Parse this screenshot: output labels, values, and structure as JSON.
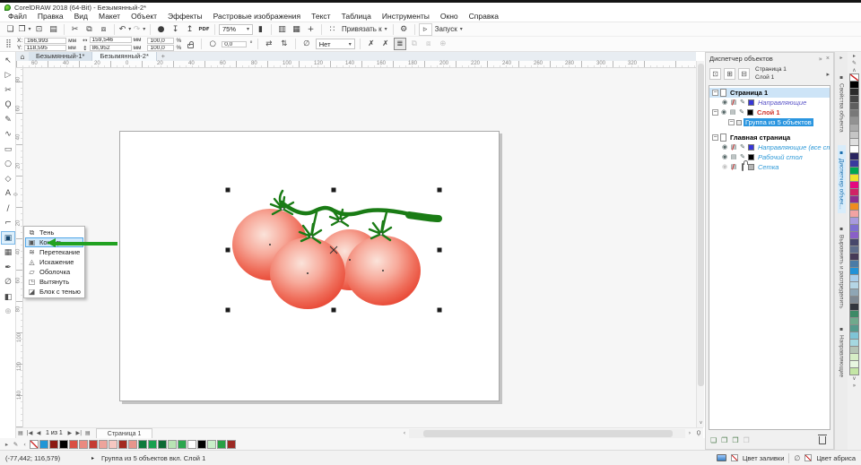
{
  "window": {
    "title": "CorelDRAW 2018 (64-Bit) - Безымянный-2*"
  },
  "icons": {
    "home": "⌂",
    "caret_down": "▾",
    "close": "×",
    "chevrons": "»",
    "play": "▸",
    "nav_first": "|◀",
    "nav_prev": "◀",
    "nav_next": "▶",
    "nav_last": "▶|",
    "page_list": "▤",
    "scroll_up": "∧",
    "scroll_down": "∨",
    "scroll_left": "‹",
    "scroll_right": "›",
    "palette_eyedropper": "✎",
    "rotation": "○",
    "degree": "°",
    "mirror_h": "⇄",
    "mirror_v": "⇅",
    "width_icon": "↔",
    "height_icon": "↕",
    "position_grid": "⣿",
    "outline_pen": "∅",
    "corner_zoom": "Ϙ",
    "dock_arrow": "▸"
  },
  "menubar": {
    "items": [
      {
        "name": "menu-file",
        "label": "Файл"
      },
      {
        "name": "menu-edit",
        "label": "Правка"
      },
      {
        "name": "menu-view",
        "label": "Вид"
      },
      {
        "name": "menu-layout",
        "label": "Макет"
      },
      {
        "name": "menu-object",
        "label": "Объект"
      },
      {
        "name": "menu-effects",
        "label": "Эффекты"
      },
      {
        "name": "menu-bitmaps",
        "label": "Растровые изображения"
      },
      {
        "name": "menu-text",
        "label": "Текст"
      },
      {
        "name": "menu-table",
        "label": "Таблица"
      },
      {
        "name": "menu-tools",
        "label": "Инструменты"
      },
      {
        "name": "menu-window",
        "label": "Окно"
      },
      {
        "name": "menu-help",
        "label": "Справка"
      }
    ]
  },
  "toolbar": {
    "zoom_level": "75%",
    "snap_label": "Привязать к",
    "launch_label": "Запуск",
    "items": [
      {
        "t": "btn",
        "n": "new-document-button",
        "g": "❏"
      },
      {
        "t": "btn",
        "n": "open-button",
        "g": "❐",
        "drop": true
      },
      {
        "t": "btn",
        "n": "save-button",
        "g": "⊡"
      },
      {
        "t": "btn",
        "n": "print-button",
        "g": "▤"
      },
      {
        "t": "sep"
      },
      {
        "t": "btn",
        "n": "cut-button",
        "g": "✂"
      },
      {
        "t": "btn",
        "n": "copy-button",
        "g": "⧉"
      },
      {
        "t": "btn",
        "n": "paste-button",
        "g": "⧈"
      },
      {
        "t": "sep"
      },
      {
        "t": "btn",
        "n": "undo-button",
        "g": "↶",
        "drop": true
      },
      {
        "t": "btn",
        "n": "redo-button",
        "g": "↷",
        "drop": true,
        "dis": true
      },
      {
        "t": "sep"
      },
      {
        "t": "btn",
        "n": "search-content-button",
        "g": "●"
      },
      {
        "t": "btn",
        "n": "import-button",
        "g": "↧"
      },
      {
        "t": "btn",
        "n": "export-button",
        "g": "↥"
      },
      {
        "t": "btn",
        "n": "publish-pdf-button",
        "g": "PDF",
        "small": true
      },
      {
        "t": "sep"
      },
      {
        "t": "combo",
        "n": "zoom-level-combo",
        "bind": "toolbar.zoom_level"
      },
      {
        "t": "btn",
        "n": "full-screen-preview-button",
        "g": "▮"
      },
      {
        "t": "sep"
      },
      {
        "t": "btn",
        "n": "show-rulers-button",
        "g": "▥"
      },
      {
        "t": "btn",
        "n": "show-grid-button",
        "g": "▦"
      },
      {
        "t": "btn",
        "n": "show-guidelines-button",
        "g": "+"
      },
      {
        "t": "sep"
      },
      {
        "t": "btn",
        "n": "snap-icon-button",
        "g": "∷"
      },
      {
        "t": "text",
        "n": "snap-to-dropdown",
        "bind": "toolbar.snap_label",
        "drop": true
      },
      {
        "t": "sep"
      },
      {
        "t": "btn",
        "n": "options-button",
        "g": "⚙"
      },
      {
        "t": "sep"
      },
      {
        "t": "btn",
        "n": "launch-icon-button",
        "g": "▹",
        "box": true
      },
      {
        "t": "text",
        "n": "launch-dropdown",
        "bind": "toolbar.launch_label",
        "drop": true
      }
    ]
  },
  "propbar": {
    "x_label": "X:",
    "y_label": "Y:",
    "x": "166,993",
    "y": "118,595",
    "unit": "мм",
    "width": "159,546",
    "height": "86,952",
    "scale_x": "100,0",
    "scale_y": "100,0",
    "percent": "%",
    "rotation": "0,0",
    "outline_width": "Нет",
    "buttons": [
      {
        "n": "clear-fill-eyedropper-button",
        "g": "✗"
      },
      {
        "n": "clear-outline-eyedropper-button",
        "g": "✗"
      },
      {
        "n": "wrap-text-button",
        "g": "≣",
        "pressed": true
      },
      {
        "n": "group-objects-button",
        "g": "⧉",
        "dis": true
      },
      {
        "n": "ungroup-objects-button",
        "g": "⧈",
        "dis": true
      },
      {
        "n": "quick-customize-button",
        "g": "⊕",
        "dis": true
      }
    ]
  },
  "toolbox": {
    "tools": [
      {
        "n": "pick-tool",
        "g": "↖"
      },
      {
        "n": "shape-tool",
        "g": "▷"
      },
      {
        "n": "crop-tool",
        "g": "✂"
      },
      {
        "n": "zoom-tool",
        "g": "Ϙ"
      },
      {
        "n": "freehand-tool",
        "g": "✎"
      },
      {
        "n": "artistic-media-tool",
        "g": "∿"
      },
      {
        "n": "rectangle-tool",
        "g": "▭"
      },
      {
        "n": "ellipse-tool",
        "g": "○"
      },
      {
        "n": "polygon-tool",
        "g": "◇"
      },
      {
        "n": "text-tool",
        "g": "A"
      },
      {
        "n": "dimension-tool",
        "g": "∕"
      },
      {
        "n": "connector-tool",
        "g": "⌐"
      },
      {
        "n": "effects-tool",
        "g": "▣",
        "active": true
      },
      {
        "n": "transparency-tool",
        "g": "▦"
      },
      {
        "n": "eyedropper-tool",
        "g": "✒"
      },
      {
        "n": "outline-pen-tool",
        "g": "∅"
      },
      {
        "n": "interactive-fill-tool",
        "g": "◧"
      },
      {
        "n": "add-tools-button",
        "g": "⊕",
        "dim": true
      }
    ]
  },
  "document_tabs": {
    "tabs": [
      {
        "name": "document-tab-1",
        "label": "Безымянный-1*",
        "active": false
      },
      {
        "name": "document-tab-2",
        "label": "Безымянный-2*",
        "active": true
      }
    ],
    "new_tab_label": "+"
  },
  "flyout": {
    "items": [
      {
        "name": "flyout-item-shadow",
        "label": "Тень",
        "g": "⧉"
      },
      {
        "name": "flyout-item-contour",
        "label": "Контур",
        "g": "▣",
        "hl": true
      },
      {
        "name": "flyout-item-blend",
        "label": "Перетекание",
        "g": "≋"
      },
      {
        "name": "flyout-item-distort",
        "label": "Искажение",
        "g": "◬"
      },
      {
        "name": "flyout-item-envelope",
        "label": "Оболочка",
        "g": "▱"
      },
      {
        "name": "flyout-item-extrude",
        "label": "Вытянуть",
        "g": "◳"
      },
      {
        "name": "flyout-item-block-shadow",
        "label": "Блок с тенью",
        "g": "◪"
      }
    ]
  },
  "rulers": {
    "h_labels": [
      "60",
      "40",
      "20",
      "0",
      "20",
      "40",
      "60",
      "80",
      "100",
      "120",
      "140",
      "160",
      "180",
      "200",
      "220",
      "240",
      "260",
      "280",
      "300",
      "320"
    ],
    "v_labels": [
      "80",
      "60",
      "40",
      "20",
      "0",
      "20",
      "40",
      "60",
      "80",
      "100",
      "120",
      "140"
    ]
  },
  "object_manager": {
    "title": "Диспетчер объектов",
    "context_page": "Страница 1",
    "context_layer": "Слой 1",
    "toolbar_buttons": [
      {
        "n": "show-object-properties-button",
        "g": "⊡"
      },
      {
        "n": "edit-across-layers-button",
        "g": "⊞"
      },
      {
        "n": "layer-manager-view-button",
        "g": "⊟"
      }
    ],
    "tree": [
      {
        "name": "page-1-row",
        "type": "page",
        "label": "Страница 1",
        "highlight": true
      },
      {
        "name": "guides-layer-row",
        "type": "layer",
        "label": "Направляющие",
        "swatch": "#3737d8",
        "italic": true,
        "color": "#5b55c8",
        "eye": true,
        "print": false,
        "edit": "pencil"
      },
      {
        "name": "layer-1-row",
        "type": "layer",
        "label": "Слой 1",
        "swatch": "#000000",
        "bold": true,
        "color": "#d2342a",
        "eye": true,
        "print": true,
        "edit": "pencil",
        "expander": true
      },
      {
        "name": "group-of-5-objects-row",
        "type": "object",
        "label": "Группа из 5 объектов",
        "selected": true
      },
      {
        "name": "master-page-row",
        "type": "page",
        "label": "Главная страница",
        "gap": true
      },
      {
        "name": "master-guides-row",
        "type": "layer",
        "label": "Направляющие (все страницы)",
        "swatch": "#3737d8",
        "italic": true,
        "color": "#2f9ad8",
        "eye": true,
        "print": false,
        "edit": "pencil"
      },
      {
        "name": "desktop-layer-row",
        "type": "layer",
        "label": "Рабочий стол",
        "swatch": "#000000",
        "italic": true,
        "color": "#2f9ad8",
        "eye": true,
        "print": true,
        "edit": "pencil"
      },
      {
        "name": "grid-layer-row",
        "type": "layer",
        "label": "Сетка",
        "swatch": "#b5b5b5",
        "italic": true,
        "color": "#2f9ad8",
        "eye": false,
        "print": false,
        "edit": "lock"
      }
    ],
    "buttons": [
      {
        "n": "new-layer-button",
        "g": "❏"
      },
      {
        "n": "new-master-layer-all-button",
        "g": "❐"
      },
      {
        "n": "new-master-layer-odd-button",
        "g": "❐"
      },
      {
        "n": "new-master-layer-even-button",
        "g": "❐",
        "dis": true
      }
    ]
  },
  "docker_tabs": {
    "items": [
      {
        "name": "tab-object-properties",
        "label": "Свойства объекта",
        "active": false
      },
      {
        "name": "tab-object-manager",
        "label": "Диспетчер объек...",
        "active": true
      },
      {
        "name": "tab-align-distribute",
        "label": "Выровнять и распределить",
        "active": false
      },
      {
        "name": "tab-guidelines",
        "label": "Направляющие",
        "active": false
      }
    ]
  },
  "palettes": {
    "right": [
      "#000000",
      "#2b2b2b",
      "#454545",
      "#5e5e5e",
      "#787878",
      "#929292",
      "#ababab",
      "#c5c5c5",
      "#dfdfdf",
      "#ffffff",
      "#2a2560",
      "#3a3a9e",
      "#00a651",
      "#f0e22d",
      "#e5097f",
      "#cf2366",
      "#8b2f8f",
      "#f08c1e",
      "#f2a3a3",
      "#a89ade",
      "#7d6fd0",
      "#8a5fc8",
      "#47476b",
      "#5d6b8a",
      "#463a57",
      "#4a7ba6",
      "#2191d6",
      "#a8cdea",
      "#b5d5e5",
      "#8fa6b5",
      "#7d8791",
      "#33363d",
      "#3d8a66",
      "#6fa98c",
      "#549a8c",
      "#7fc4d6",
      "#a5d8e0",
      "#b5c4b5",
      "#d6edc6",
      "#e8f7e0",
      "#c4e6a5"
    ],
    "document": [
      "#2196d6",
      "#8b1a12",
      "#000000",
      "#d94f43",
      "#ea8a80",
      "#c43c32",
      "#eda49c",
      "#f6c7c1",
      "#a32a1f",
      "#e8958c",
      "#0e7a3c",
      "#17a04e",
      "#0c6a34",
      "#b9e4b4",
      "#2ca64e",
      "#ffffff",
      "#000000",
      "#c9eec9",
      "#28a044",
      "#9c2a24"
    ]
  },
  "page_nav": {
    "pages_label": "1 из 1",
    "page_tab": "Страница 1"
  },
  "status_bar": {
    "coords": "(-77,442; 116,579)",
    "object_info": "Группа из 5 объектов вкл. Слой 1",
    "fill_label": "Цвет заливки",
    "outline_label": "Цвет абриса"
  },
  "colors": {
    "tomato_highlight": "#fbe3da",
    "tomato_mid": "#f7ab9c",
    "tomato_deep": "#ef6d5a",
    "tomato_red": "#e63b28",
    "vine_green": "#1a7c15",
    "callout_green": "#21a121",
    "selection_blue": "#2b96e0"
  }
}
